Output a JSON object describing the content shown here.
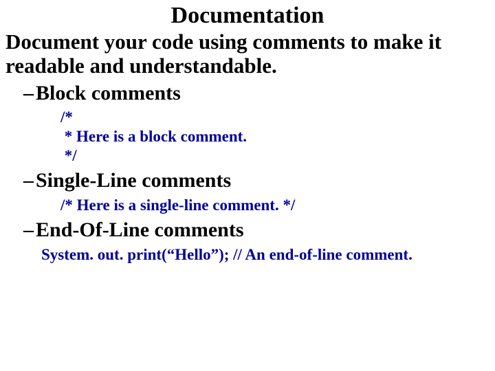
{
  "title": "Documentation",
  "intro": "Document your code using comments to make it readable and understandable.",
  "bullets": {
    "b1": {
      "label": "Block comments",
      "code": "/*\n * Here is a block comment.\n */"
    },
    "b2": {
      "label": "Single-Line comments",
      "code": "/* Here is a single-line comment. */"
    },
    "b3": {
      "label": "End-Of-Line comments",
      "code": "System. out. print(“Hello”); // An end-of-line comment."
    }
  }
}
